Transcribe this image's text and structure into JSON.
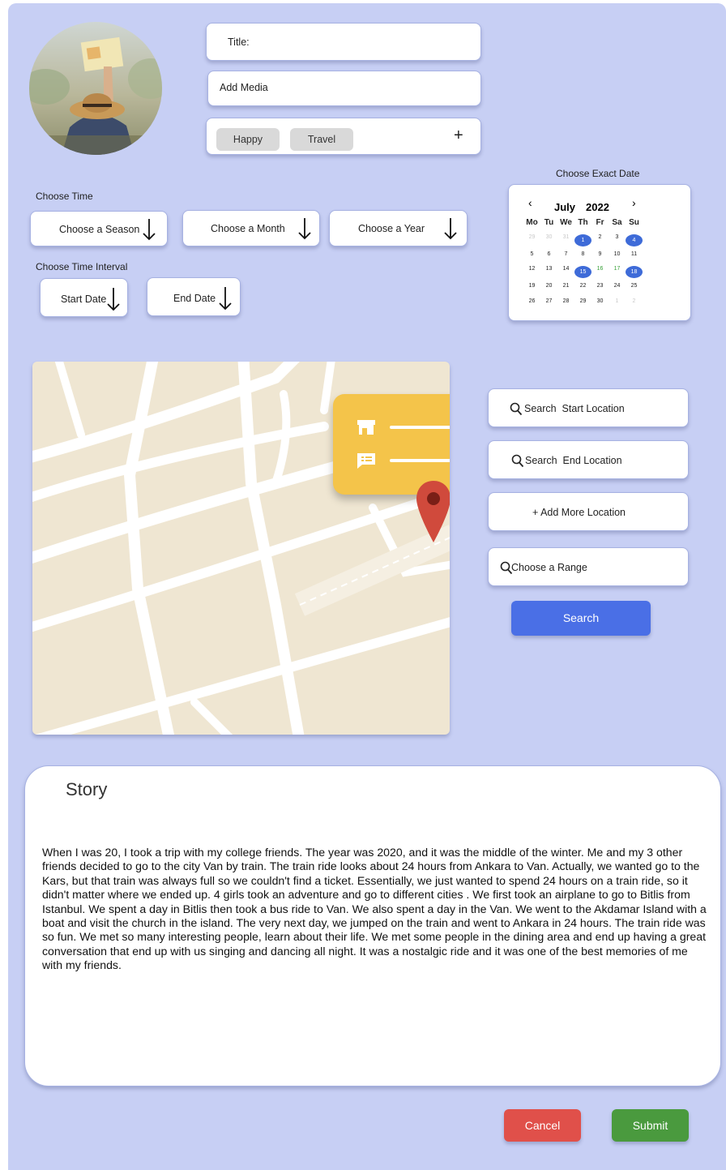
{
  "form": {
    "title_label": "Title:",
    "add_media_label": "Add Media",
    "tags": [
      "Happy",
      "Travel"
    ],
    "add_tag_symbol": "+"
  },
  "time": {
    "choose_time_label": "Choose Time",
    "season_label": "Choose a Season",
    "month_label": "Choose a Month",
    "year_label": "Choose a Year",
    "interval_label": "Choose Time Interval",
    "start_date_label": "Start Date",
    "end_date_label": "End Date"
  },
  "calendar": {
    "title": "Choose Exact Date",
    "prev": "‹",
    "next": "›",
    "month": "July",
    "year": "2022",
    "weekdays": [
      "Mo",
      "Tu",
      "We",
      "Th",
      "Fr",
      "Sa",
      "Su"
    ],
    "weeks": [
      [
        "29",
        "30",
        "31",
        "1",
        "2",
        "3",
        "4"
      ],
      [
        "5",
        "6",
        "7",
        "8",
        "9",
        "10",
        "11"
      ],
      [
        "12",
        "13",
        "14",
        "15",
        "16",
        "17",
        "18"
      ],
      [
        "19",
        "20",
        "21",
        "22",
        "23",
        "24",
        "25"
      ],
      [
        "26",
        "27",
        "28",
        "29",
        "30",
        "1",
        "2"
      ]
    ]
  },
  "location": {
    "start": "Search  Start Location",
    "end": "Search  End Location",
    "add_more": "+ Add More Location",
    "range": "Choose a Range",
    "search_button": "Search"
  },
  "story": {
    "heading": "Story",
    "body": "When I was 20, I took a trip with my college friends. The year was 2020, and it was the middle of the winter. Me and my 3 other friends decided to go to the city Van by train. The train ride looks about 24 hours from Ankara to Van. Actually, we wanted go to the Kars, but that train was always full so we couldn't find a ticket. Essentially, we just wanted to spend 24 hours on a train ride, so it didn't matter where we ended up. 4 girls took an adventure and go to different cities . We first took an airplane to go to Bitlis from Istanbul. We spent a day in Bitlis then took a bus ride to Van. We also spent a day in the Van. We went to the Akdamar Island with a boat and visit the church in the island. The very next day, we jumped on the train and went to Ankara in 24 hours. The train ride was so fun. We met so many interesting people, learn about their life. We met some people in the dining area and end up having a great conversation that end up with us singing and dancing all night. It was a nostalgic ride and it was one of the best memories of me with my friends."
  },
  "actions": {
    "cancel": "Cancel",
    "submit": "Submit"
  },
  "colors": {
    "background": "#c7cff4",
    "primary": "#4a6fe6",
    "cancel": "#e0504a",
    "submit": "#4a9a3e",
    "map_popup": "#f4c44a",
    "map_pin": "#d04a3c"
  }
}
